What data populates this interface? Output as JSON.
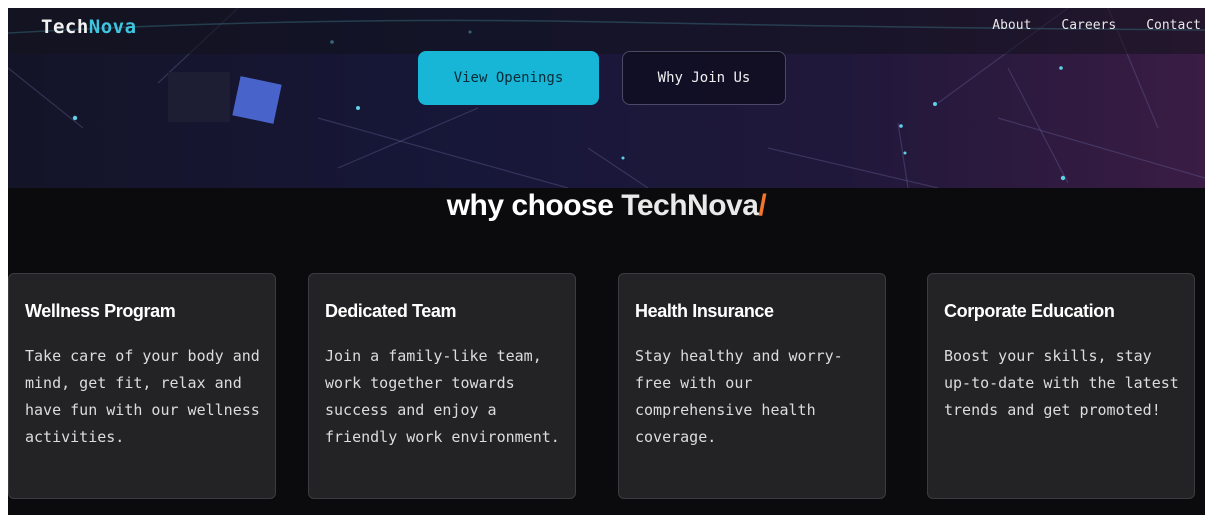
{
  "brand": {
    "name_part1": "Tech",
    "name_part2": "Nova",
    "accent_color": "#3ec6e0"
  },
  "nav": {
    "links": [
      {
        "label": "About"
      },
      {
        "label": "Careers"
      },
      {
        "label": "Contact"
      }
    ]
  },
  "hero": {
    "primary_button": "View Openings",
    "secondary_button": "Why Join Us"
  },
  "section": {
    "title_prefix": "why choose ",
    "title_brand": "TechNova",
    "title_suffix": "/"
  },
  "cards": [
    {
      "title": "Wellness Program",
      "text": "Take care of your body and mind, get fit, relax and have fun with our wellness activities."
    },
    {
      "title": "Dedicated Team",
      "text": "Join a family-like team, work together towards success and enjoy a friendly work environment."
    },
    {
      "title": "Health Insurance",
      "text": "Stay healthy and worry-free with our comprehensive health coverage."
    },
    {
      "title": "Corporate Education",
      "text": "Boost your skills, stay up-to-date with the latest trends and get promoted!"
    }
  ],
  "colors": {
    "primary_button": "#17b6d6",
    "slash_accent": "#f0762a",
    "card_bg": "#232325"
  }
}
